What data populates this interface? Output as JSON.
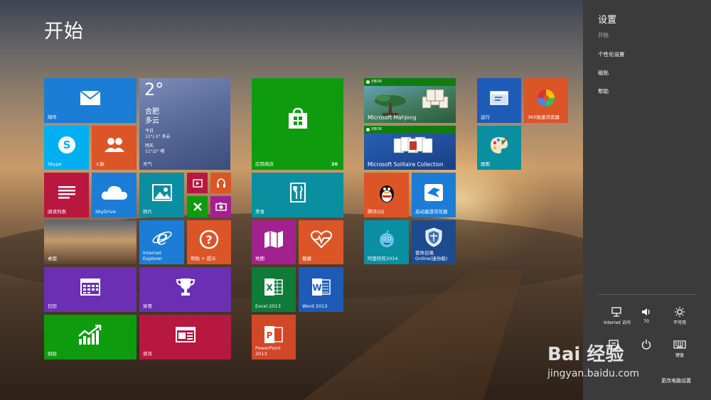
{
  "screen": {
    "title": "开始"
  },
  "tiles": {
    "mail": {
      "label": "邮件"
    },
    "weather": {
      "temp": "2°",
      "city": "合肥",
      "condition": "多云",
      "today": "今日",
      "today_range": "11°/-1° 多云",
      "tomorrow": "明天",
      "tomorrow_range": "11°/2° 晴",
      "label": "天气"
    },
    "skype": {
      "label": "Skype"
    },
    "people": {
      "label": "人脉"
    },
    "reading_list": {
      "label": "阅读列表"
    },
    "skydrive": {
      "label": "SkyDrive"
    },
    "photos": {
      "label": "照片"
    },
    "desktop": {
      "label": "桌面"
    },
    "ie": {
      "label": "Internet\nExplorer"
    },
    "help": {
      "label": "帮助 + 提示"
    },
    "calendar": {
      "label": "日历"
    },
    "sports": {
      "label": "体育"
    },
    "finance": {
      "label": "财经"
    },
    "news": {
      "label": "资讯"
    },
    "store": {
      "label": "应用商店",
      "badge": "20"
    },
    "food": {
      "label": "美食"
    },
    "maps": {
      "label": "地图"
    },
    "health": {
      "label": "健康"
    },
    "excel": {
      "label": "Excel 2013"
    },
    "word": {
      "label": "Word 2013"
    },
    "powerpoint": {
      "label": "PowerPoint\n2013"
    },
    "mahjong": {
      "brand": "XBOX",
      "label": "Microsoft Mahjong"
    },
    "solitaire": {
      "brand": "XBOX",
      "label": "Microsoft Solitaire Collection"
    },
    "qq": {
      "label": "腾讯QQ"
    },
    "qq_browser": {
      "label": "启动遨游浏览器"
    },
    "aliwangwang": {
      "label": "阿里旺旺2014"
    },
    "game_online": {
      "label": "使命召唤\nOnline(迷你版)"
    },
    "run": {
      "label": "运行"
    },
    "browser360": {
      "label": "360极速浏览器"
    },
    "paint": {
      "label": "画图"
    }
  },
  "settings": {
    "title": "设置",
    "items": [
      "开始",
      "个性化设置",
      "磁贴",
      "帮助"
    ],
    "quick": [
      {
        "label": "Internet 访问"
      },
      {
        "label": "70"
      },
      {
        "label": "不可用"
      },
      {
        "label": ""
      },
      {
        "label": ""
      },
      {
        "label": "键盘"
      }
    ],
    "change_pc_settings": "更改电脑设置"
  },
  "watermark": {
    "logo": "Bai 经验",
    "url": "jingyan.baidu.com"
  },
  "colors": {
    "blue": "#1b7dd6",
    "orange": "#dc5527",
    "red": "#b8173f",
    "purple": "#6b2fb3",
    "green": "#0e9c0e",
    "teal": "#0a8fa0",
    "magenta": "#a3218f",
    "panel": "#3b3b3b"
  }
}
